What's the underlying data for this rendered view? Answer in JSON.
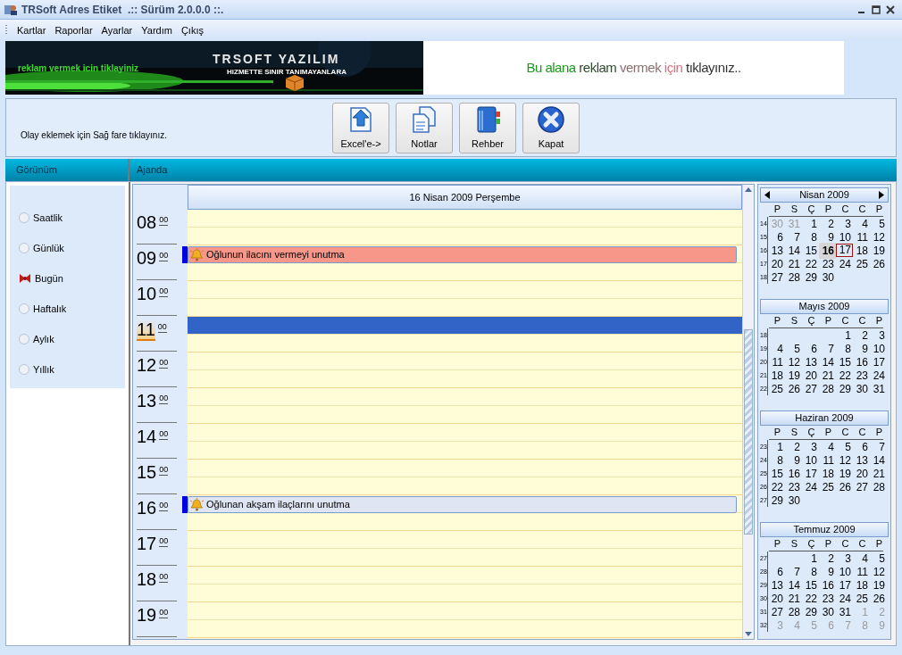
{
  "window": {
    "title": "TRSoft Adres Etiket  .:: Sürüm 2.0.0.0 ::."
  },
  "menu": [
    "Kartlar",
    "Raporlar",
    "Ayarlar",
    "Yardım",
    "Çıkış"
  ],
  "banner": {
    "left_tagline": "reklam vermek icin tiklayiniz",
    "left_title": "TRSOFT YAZILIM",
    "left_subtitle": "HiZMETTE SINIR TANIMAYANLARA",
    "right_parts": [
      {
        "text": "Bu alana ",
        "color": "#1a9a1a"
      },
      {
        "text": "reklam ",
        "color": "#2d4a2d"
      },
      {
        "text": "vermek ",
        "color": "#8a7070"
      },
      {
        "text": "için ",
        "color": "#d87080"
      },
      {
        "text": "tıklayınız..",
        "color": "#333333"
      }
    ]
  },
  "toolbar": {
    "hint": "Olay eklemek için Sağ fare tıklayınız.",
    "buttons": [
      {
        "label": "Excel'e->",
        "kind": "excel"
      },
      {
        "label": "Notlar",
        "kind": "notes"
      },
      {
        "label": "Rehber",
        "kind": "book"
      },
      {
        "label": "Kapat",
        "kind": "close"
      }
    ]
  },
  "view_panel": {
    "title": "Görünüm",
    "options": [
      {
        "label": "Saatlik",
        "selected": false
      },
      {
        "label": "Günlük",
        "selected": false
      },
      {
        "label": "Bugün",
        "selected": true
      },
      {
        "label": "Haftalık",
        "selected": false
      },
      {
        "label": "Aylık",
        "selected": false
      },
      {
        "label": "Yıllık",
        "selected": false
      }
    ]
  },
  "agenda": {
    "title": "Ajanda",
    "date_header": "16 Nisan 2009 Perşembe",
    "hours": [
      {
        "label": "08",
        "minutes": "00",
        "current": false,
        "selected": false
      },
      {
        "label": "09",
        "minutes": "00",
        "current": false,
        "selected": false,
        "event": {
          "text": "Oğlunun ilacını vermeyi unutma",
          "color": "#f7978a"
        }
      },
      {
        "label": "10",
        "minutes": "00",
        "current": false,
        "selected": false
      },
      {
        "label": "11",
        "minutes": "00",
        "current": true,
        "selected": true
      },
      {
        "label": "12",
        "minutes": "00",
        "current": false,
        "selected": false
      },
      {
        "label": "13",
        "minutes": "00",
        "current": false,
        "selected": false
      },
      {
        "label": "14",
        "minutes": "00",
        "current": false,
        "selected": false
      },
      {
        "label": "15",
        "minutes": "00",
        "current": false,
        "selected": false
      },
      {
        "label": "16",
        "minutes": "00",
        "current": false,
        "selected": false,
        "event": {
          "text": "Oğlunan akşam ilaçlarını unutma",
          "color": "#dfe5f2"
        }
      },
      {
        "label": "17",
        "minutes": "00",
        "current": false,
        "selected": false
      },
      {
        "label": "18",
        "minutes": "00",
        "current": false,
        "selected": false
      },
      {
        "label": "19",
        "minutes": "00",
        "current": false,
        "selected": false
      }
    ]
  },
  "calendar": {
    "months": [
      {
        "title": "Nisan 2009",
        "arrows": true,
        "weekdays": [
          "P",
          "S",
          "Ç",
          "P",
          "C",
          "C",
          "P"
        ],
        "weeks": [
          {
            "number": "14",
            "days": [
              {
                "d": "30",
                "kind": "other"
              },
              {
                "d": "31",
                "kind": "other"
              },
              {
                "d": "1",
                "kind": "day"
              },
              {
                "d": "2",
                "kind": "day"
              },
              {
                "d": "3",
                "kind": "day"
              },
              {
                "d": "4",
                "kind": "day"
              },
              {
                "d": "5",
                "kind": "day"
              }
            ]
          },
          {
            "number": "15",
            "days": [
              {
                "d": "6",
                "kind": "day"
              },
              {
                "d": "7",
                "kind": "day"
              },
              {
                "d": "8",
                "kind": "day"
              },
              {
                "d": "9",
                "kind": "day"
              },
              {
                "d": "10",
                "kind": "day"
              },
              {
                "d": "11",
                "kind": "day"
              },
              {
                "d": "12",
                "kind": "day"
              }
            ]
          },
          {
            "number": "16",
            "days": [
              {
                "d": "13",
                "kind": "day"
              },
              {
                "d": "14",
                "kind": "day"
              },
              {
                "d": "15",
                "kind": "day"
              },
              {
                "d": "16",
                "kind": "current"
              },
              {
                "d": "17",
                "kind": "today"
              },
              {
                "d": "18",
                "kind": "day"
              },
              {
                "d": "19",
                "kind": "day"
              }
            ]
          },
          {
            "number": "17",
            "days": [
              {
                "d": "20",
                "kind": "day"
              },
              {
                "d": "21",
                "kind": "day"
              },
              {
                "d": "22",
                "kind": "day"
              },
              {
                "d": "23",
                "kind": "day"
              },
              {
                "d": "24",
                "kind": "day"
              },
              {
                "d": "25",
                "kind": "day"
              },
              {
                "d": "26",
                "kind": "day"
              }
            ]
          },
          {
            "number": "18",
            "days": [
              {
                "d": "27",
                "kind": "day"
              },
              {
                "d": "28",
                "kind": "day"
              },
              {
                "d": "29",
                "kind": "day"
              },
              {
                "d": "30",
                "kind": "day"
              },
              {
                "kind": "blank"
              },
              {
                "kind": "blank"
              },
              {
                "kind": "blank"
              }
            ]
          }
        ]
      },
      {
        "title": "Mayıs 2009",
        "arrows": false,
        "weekdays": [
          "P",
          "S",
          "Ç",
          "P",
          "C",
          "C",
          "P"
        ],
        "weeks": [
          {
            "number": "18",
            "days": [
              {
                "kind": "blank"
              },
              {
                "kind": "blank"
              },
              {
                "kind": "blank"
              },
              {
                "kind": "blank"
              },
              {
                "d": "1",
                "kind": "day"
              },
              {
                "d": "2",
                "kind": "day"
              },
              {
                "d": "3",
                "kind": "day"
              }
            ]
          },
          {
            "number": "19",
            "days": [
              {
                "d": "4",
                "kind": "day"
              },
              {
                "d": "5",
                "kind": "day"
              },
              {
                "d": "6",
                "kind": "day"
              },
              {
                "d": "7",
                "kind": "day"
              },
              {
                "d": "8",
                "kind": "day"
              },
              {
                "d": "9",
                "kind": "day"
              },
              {
                "d": "10",
                "kind": "day"
              }
            ]
          },
          {
            "number": "20",
            "days": [
              {
                "d": "11",
                "kind": "day"
              },
              {
                "d": "12",
                "kind": "day"
              },
              {
                "d": "13",
                "kind": "day"
              },
              {
                "d": "14",
                "kind": "day"
              },
              {
                "d": "15",
                "kind": "day"
              },
              {
                "d": "16",
                "kind": "day"
              },
              {
                "d": "17",
                "kind": "day"
              }
            ]
          },
          {
            "number": "21",
            "days": [
              {
                "d": "18",
                "kind": "day"
              },
              {
                "d": "19",
                "kind": "day"
              },
              {
                "d": "20",
                "kind": "day"
              },
              {
                "d": "21",
                "kind": "day"
              },
              {
                "d": "22",
                "kind": "day"
              },
              {
                "d": "23",
                "kind": "day"
              },
              {
                "d": "24",
                "kind": "day"
              }
            ]
          },
          {
            "number": "22",
            "days": [
              {
                "d": "25",
                "kind": "day"
              },
              {
                "d": "26",
                "kind": "day"
              },
              {
                "d": "27",
                "kind": "day"
              },
              {
                "d": "28",
                "kind": "day"
              },
              {
                "d": "29",
                "kind": "day"
              },
              {
                "d": "30",
                "kind": "day"
              },
              {
                "d": "31",
                "kind": "day"
              }
            ]
          }
        ]
      },
      {
        "title": "Haziran 2009",
        "arrows": false,
        "weekdays": [
          "P",
          "S",
          "Ç",
          "P",
          "C",
          "C",
          "P"
        ],
        "weeks": [
          {
            "number": "23",
            "days": [
              {
                "d": "1",
                "kind": "day"
              },
              {
                "d": "2",
                "kind": "day"
              },
              {
                "d": "3",
                "kind": "day"
              },
              {
                "d": "4",
                "kind": "day"
              },
              {
                "d": "5",
                "kind": "day"
              },
              {
                "d": "6",
                "kind": "day"
              },
              {
                "d": "7",
                "kind": "day"
              }
            ]
          },
          {
            "number": "24",
            "days": [
              {
                "d": "8",
                "kind": "day"
              },
              {
                "d": "9",
                "kind": "day"
              },
              {
                "d": "10",
                "kind": "day"
              },
              {
                "d": "11",
                "kind": "day"
              },
              {
                "d": "12",
                "kind": "day"
              },
              {
                "d": "13",
                "kind": "day"
              },
              {
                "d": "14",
                "kind": "day"
              }
            ]
          },
          {
            "number": "25",
            "days": [
              {
                "d": "15",
                "kind": "day"
              },
              {
                "d": "16",
                "kind": "day"
              },
              {
                "d": "17",
                "kind": "day"
              },
              {
                "d": "18",
                "kind": "day"
              },
              {
                "d": "19",
                "kind": "day"
              },
              {
                "d": "20",
                "kind": "day"
              },
              {
                "d": "21",
                "kind": "day"
              }
            ]
          },
          {
            "number": "26",
            "days": [
              {
                "d": "22",
                "kind": "day"
              },
              {
                "d": "23",
                "kind": "day"
              },
              {
                "d": "24",
                "kind": "day"
              },
              {
                "d": "25",
                "kind": "day"
              },
              {
                "d": "26",
                "kind": "day"
              },
              {
                "d": "27",
                "kind": "day"
              },
              {
                "d": "28",
                "kind": "day"
              }
            ]
          },
          {
            "number": "27",
            "days": [
              {
                "d": "29",
                "kind": "day"
              },
              {
                "d": "30",
                "kind": "day"
              },
              {
                "kind": "blank"
              },
              {
                "kind": "blank"
              },
              {
                "kind": "blank"
              },
              {
                "kind": "blank"
              },
              {
                "kind": "blank"
              }
            ]
          }
        ]
      },
      {
        "title": "Temmuz 2009",
        "arrows": false,
        "weekdays": [
          "P",
          "S",
          "Ç",
          "P",
          "C",
          "C",
          "P"
        ],
        "weeks": [
          {
            "number": "27",
            "days": [
              {
                "kind": "blank"
              },
              {
                "kind": "blank"
              },
              {
                "d": "1",
                "kind": "day"
              },
              {
                "d": "2",
                "kind": "day"
              },
              {
                "d": "3",
                "kind": "day"
              },
              {
                "d": "4",
                "kind": "day"
              },
              {
                "d": "5",
                "kind": "day"
              }
            ]
          },
          {
            "number": "28",
            "days": [
              {
                "d": "6",
                "kind": "day"
              },
              {
                "d": "7",
                "kind": "day"
              },
              {
                "d": "8",
                "kind": "day"
              },
              {
                "d": "9",
                "kind": "day"
              },
              {
                "d": "10",
                "kind": "day"
              },
              {
                "d": "11",
                "kind": "day"
              },
              {
                "d": "12",
                "kind": "day"
              }
            ]
          },
          {
            "number": "29",
            "days": [
              {
                "d": "13",
                "kind": "day"
              },
              {
                "d": "14",
                "kind": "day"
              },
              {
                "d": "15",
                "kind": "day"
              },
              {
                "d": "16",
                "kind": "day"
              },
              {
                "d": "17",
                "kind": "day"
              },
              {
                "d": "18",
                "kind": "day"
              },
              {
                "d": "19",
                "kind": "day"
              }
            ]
          },
          {
            "number": "30",
            "days": [
              {
                "d": "20",
                "kind": "day"
              },
              {
                "d": "21",
                "kind": "day"
              },
              {
                "d": "22",
                "kind": "day"
              },
              {
                "d": "23",
                "kind": "day"
              },
              {
                "d": "24",
                "kind": "day"
              },
              {
                "d": "25",
                "kind": "day"
              },
              {
                "d": "26",
                "kind": "day"
              }
            ]
          },
          {
            "number": "31",
            "days": [
              {
                "d": "27",
                "kind": "day"
              },
              {
                "d": "28",
                "kind": "day"
              },
              {
                "d": "29",
                "kind": "day"
              },
              {
                "d": "30",
                "kind": "day"
              },
              {
                "d": "31",
                "kind": "day"
              },
              {
                "d": "1",
                "kind": "other"
              },
              {
                "d": "2",
                "kind": "other"
              }
            ]
          },
          {
            "number": "32",
            "days": [
              {
                "d": "3",
                "kind": "other"
              },
              {
                "d": "4",
                "kind": "other"
              },
              {
                "d": "5",
                "kind": "other"
              },
              {
                "d": "6",
                "kind": "other"
              },
              {
                "d": "7",
                "kind": "other"
              },
              {
                "d": "8",
                "kind": "other"
              },
              {
                "d": "9",
                "kind": "other"
              }
            ]
          }
        ]
      }
    ]
  }
}
